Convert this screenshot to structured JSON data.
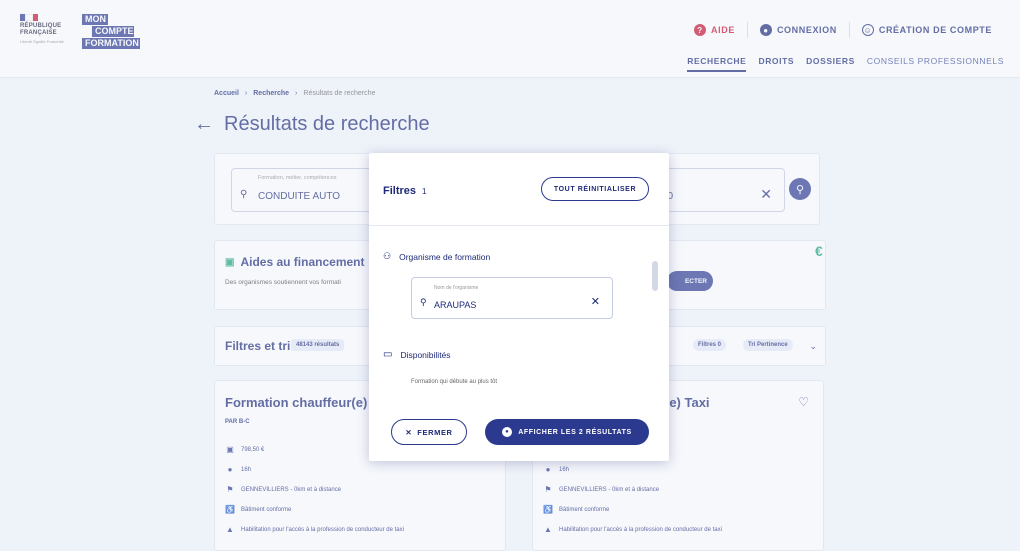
{
  "header": {
    "rf": {
      "line1": "RÉPUBLIQUE",
      "line2": "FRANÇAISE",
      "motto": "Liberté Égalité Fraternité"
    },
    "mcf": {
      "w1": "MON",
      "w2": "COMPTE",
      "w3": "FORMATION"
    },
    "links": {
      "aide": "AIDE",
      "connexion": "CONNEXION",
      "creation": "CRÉATION DE COMPTE"
    },
    "nav": [
      "RECHERCHE",
      "DROITS",
      "DOSSIERS",
      "CONSEILS PROFESSIONNELS"
    ]
  },
  "breadcrumb": {
    "home": "Accueil",
    "search": "Recherche",
    "current": "Résultats de recherche"
  },
  "page_title": "Résultats de recherche",
  "search": {
    "label": "Formation, métier, compétences",
    "value": "CONDUITE AUTO",
    "location_value": "00"
  },
  "aides": {
    "title": "Aides au financement",
    "desc": "Des organismes soutiennent vos formati",
    "button": "ECTER"
  },
  "filters_bar": {
    "title": "Filtres et tri",
    "count": "48143 résultats",
    "chip_filters": "Filtres 0",
    "chip_sort": "Tri Pertinence"
  },
  "results": [
    {
      "title": "Formation chauffeur(e)",
      "org": "PAR B-C",
      "price": "798,50 €",
      "duration": "16h",
      "location": "GENNEVILLIERS - 0km et à distance",
      "access": "Bâtiment conforme",
      "cert": "Habilitation pour l'accès à la profession de conducteur de taxi"
    },
    {
      "title": "(e) Taxi",
      "org": "",
      "price": "",
      "duration": "16h",
      "location": "GENNEVILLIERS - 0km et à distance",
      "access": "Bâtiment conforme",
      "cert": "Habilitation pour l'accès à la profession de conducteur de taxi"
    }
  ],
  "modal": {
    "title": "Filtres",
    "count": "1",
    "reset": "TOUT RÉINITIALISER",
    "section_org": "Organisme de formation",
    "org_label": "Nom de l'organisme",
    "org_value": "ARAUPAS",
    "section_dispo": "Disponibilités",
    "dispo_text": "Formation qui débute au plus tôt",
    "close": "FERMER",
    "show": "AFFICHER LES 2 RÉSULTATS"
  },
  "colors": {
    "primary": "#2b3a8f",
    "accent_red": "#c8102e",
    "euro_green": "#1aa37a"
  }
}
